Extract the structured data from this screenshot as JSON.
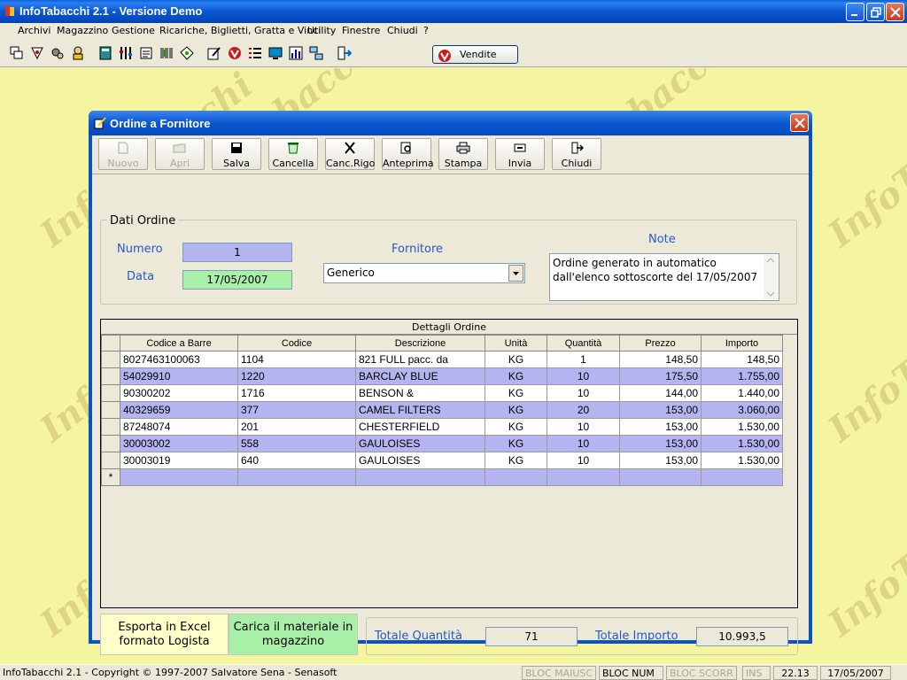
{
  "app": {
    "title": "InfoTabacchi 2.1 - Versione Demo"
  },
  "menu": [
    "Archivi",
    "Magazzino",
    "Gestione",
    "Ricariche, Biglietti, Gratta e Vinci",
    "Utility",
    "Finestre",
    "Chiudi",
    "?"
  ],
  "toolbar": {
    "icons": [
      "windows-icon",
      "paint-icon",
      "gears-icon",
      "user-icon",
      "calc-icon",
      "tools-icon",
      "list-icon",
      "barcode-icon",
      "tag-icon",
      "edit-icon",
      "vendite-icon",
      "list2-icon",
      "monitor-icon",
      "chart-icon",
      "network-icon",
      "exit-icon"
    ],
    "vendite_label": "Vendite"
  },
  "watermark": "InfoTabacchi",
  "dialog": {
    "title": "Ordine a Fornitore",
    "buttons": [
      {
        "label": "Nuovo",
        "enabled": false
      },
      {
        "label": "Apri",
        "enabled": false
      },
      {
        "label": "Salva",
        "enabled": true
      },
      {
        "label": "Cancella",
        "enabled": true
      },
      {
        "label": "Canc.Rigo",
        "enabled": true
      },
      {
        "label": "Anteprima",
        "enabled": true
      },
      {
        "label": "Stampa",
        "enabled": true
      },
      {
        "label": "Invia",
        "enabled": true
      },
      {
        "label": "Chiudi",
        "enabled": true
      }
    ],
    "group_title": "Dati Ordine",
    "numero_label": "Numero",
    "numero_value": "1",
    "data_label": "Data",
    "data_value": "17/05/2007",
    "fornitore_label": "Fornitore",
    "fornitore_value": "Generico",
    "note_label": "Note",
    "note_value": "Ordine generato in automatico dall'elenco sottoscorte del 17/05/2007",
    "grid_caption": "Dettagli Ordine",
    "columns": [
      "Codice a Barre",
      "Codice",
      "Descrizione",
      "Unità",
      "Quantità",
      "Prezzo",
      "Importo"
    ],
    "rows": [
      [
        "8027463100063",
        "1104",
        "821 FULL pacc. da",
        "KG",
        "1",
        "148,50",
        "148,50"
      ],
      [
        "54029910",
        "1220",
        "BARCLAY BLUE",
        "KG",
        "10",
        "175,50",
        "1.755,00"
      ],
      [
        "90300202",
        "1716",
        "BENSON &",
        "KG",
        "10",
        "144,00",
        "1.440,00"
      ],
      [
        "40329659",
        "377",
        "CAMEL FILTERS",
        "KG",
        "20",
        "153,00",
        "3.060,00"
      ],
      [
        "87248074",
        "201",
        "CHESTERFIELD",
        "KG",
        "10",
        "153,00",
        "1.530,00"
      ],
      [
        "30003002",
        "558",
        "GAULOISES",
        "KG",
        "10",
        "153,00",
        "1.530,00"
      ],
      [
        "30003019",
        "640",
        "GAULOISES",
        "KG",
        "10",
        "153,00",
        "1.530,00"
      ]
    ],
    "new_row_marker": "*",
    "btn_excel": "Esporta in Excel formato Logista",
    "btn_carica": "Carica il materiale in magazzino",
    "tot_qta_label": "Totale Quantità",
    "tot_qta_value": "71",
    "tot_imp_label": "Totale Importo",
    "tot_imp_value": "10.993,5"
  },
  "status": {
    "copyright": "InfoTabacchi 2.1 - Copyright © 1997-2007 Salvatore Sena - Senasoft",
    "caps": "BLOC MAIUSC",
    "num": "BLOC NUM",
    "scroll": "BLOC SCORR",
    "ins": "INS",
    "time": "22.13",
    "date": "17/05/2007"
  }
}
